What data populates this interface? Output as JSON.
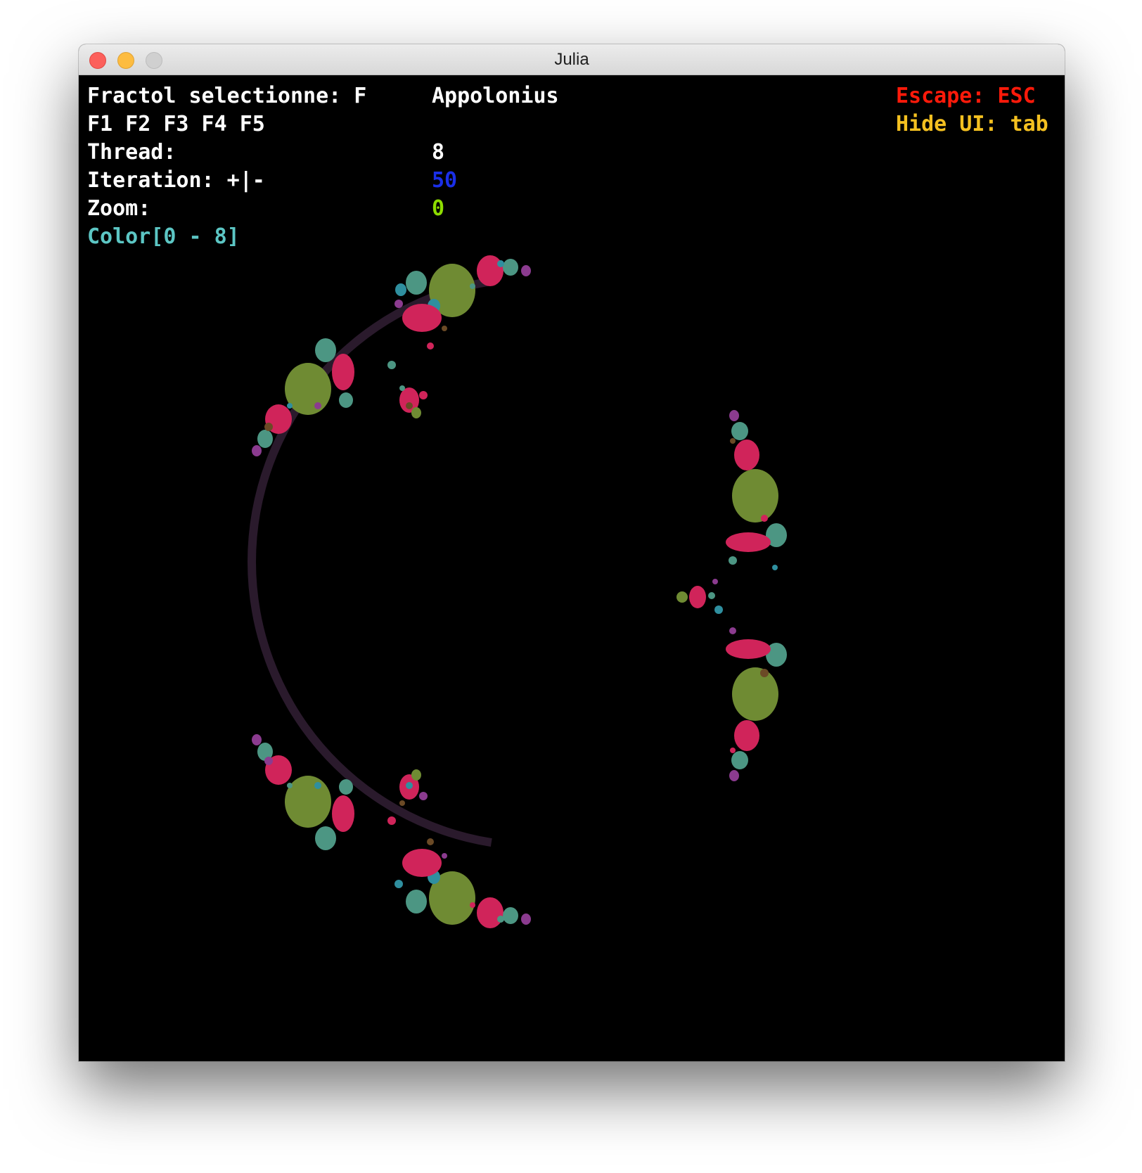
{
  "window": {
    "title": "Julia"
  },
  "hud": {
    "selected_label": "Fractol selectionne: F",
    "selected_value": "Appolonius",
    "fkeys": "F1 F2 F3 F4 F5",
    "thread_label": "Thread:",
    "thread_value": "8",
    "iteration_label": "Iteration: +|-",
    "iteration_value": "50",
    "zoom_label": "Zoom:",
    "zoom_value": "0",
    "color_label": "Color[0 - 8]",
    "escape": "Escape: ESC",
    "hide_ui": "Hide UI: tab"
  },
  "colors": {
    "iteration": "#1a2fe8",
    "zoom": "#8ddc00",
    "color_label": "#5cc6c4",
    "escape": "#ff1a0a",
    "hide_ui": "#f4c020",
    "fractal_olive": "#6f8b33",
    "fractal_crimson": "#d0245a",
    "fractal_teal": "#4c9683",
    "fractal_cyan": "#2f8f9f",
    "fractal_purple": "#8b3b8f",
    "fractal_brown": "#6b4a26"
  }
}
